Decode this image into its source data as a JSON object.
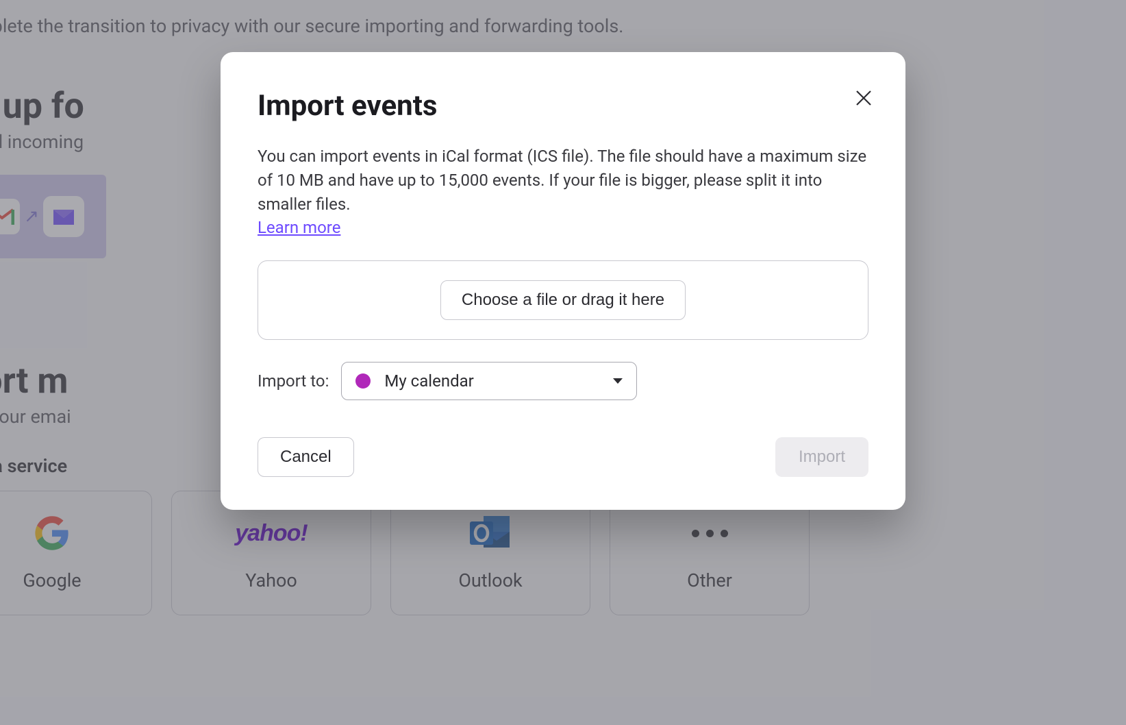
{
  "background": {
    "line1": "mplete the transition to privacy with our secure importing and forwarding tools.",
    "heading1": "et up fo",
    "line2": "ward incoming",
    "heading2": "port m",
    "line3": "ort your emai",
    "line4": "ect a service",
    "services": [
      {
        "label": "Google"
      },
      {
        "label": "Yahoo"
      },
      {
        "label": "Outlook"
      },
      {
        "label": "Other"
      }
    ]
  },
  "modal": {
    "title": "Import events",
    "description": "You can import events in iCal format (ICS file). The file should have a maximum size of 10 MB and have up to 15,000 events. If your file is bigger, please split it into smaller files.",
    "learn_more": "Learn more",
    "choose_label": "Choose a file or drag it here",
    "import_to_label": "Import to:",
    "calendar_selected": "My calendar",
    "calendar_color": "#b028b9",
    "cancel_label": "Cancel",
    "import_label": "Import"
  }
}
